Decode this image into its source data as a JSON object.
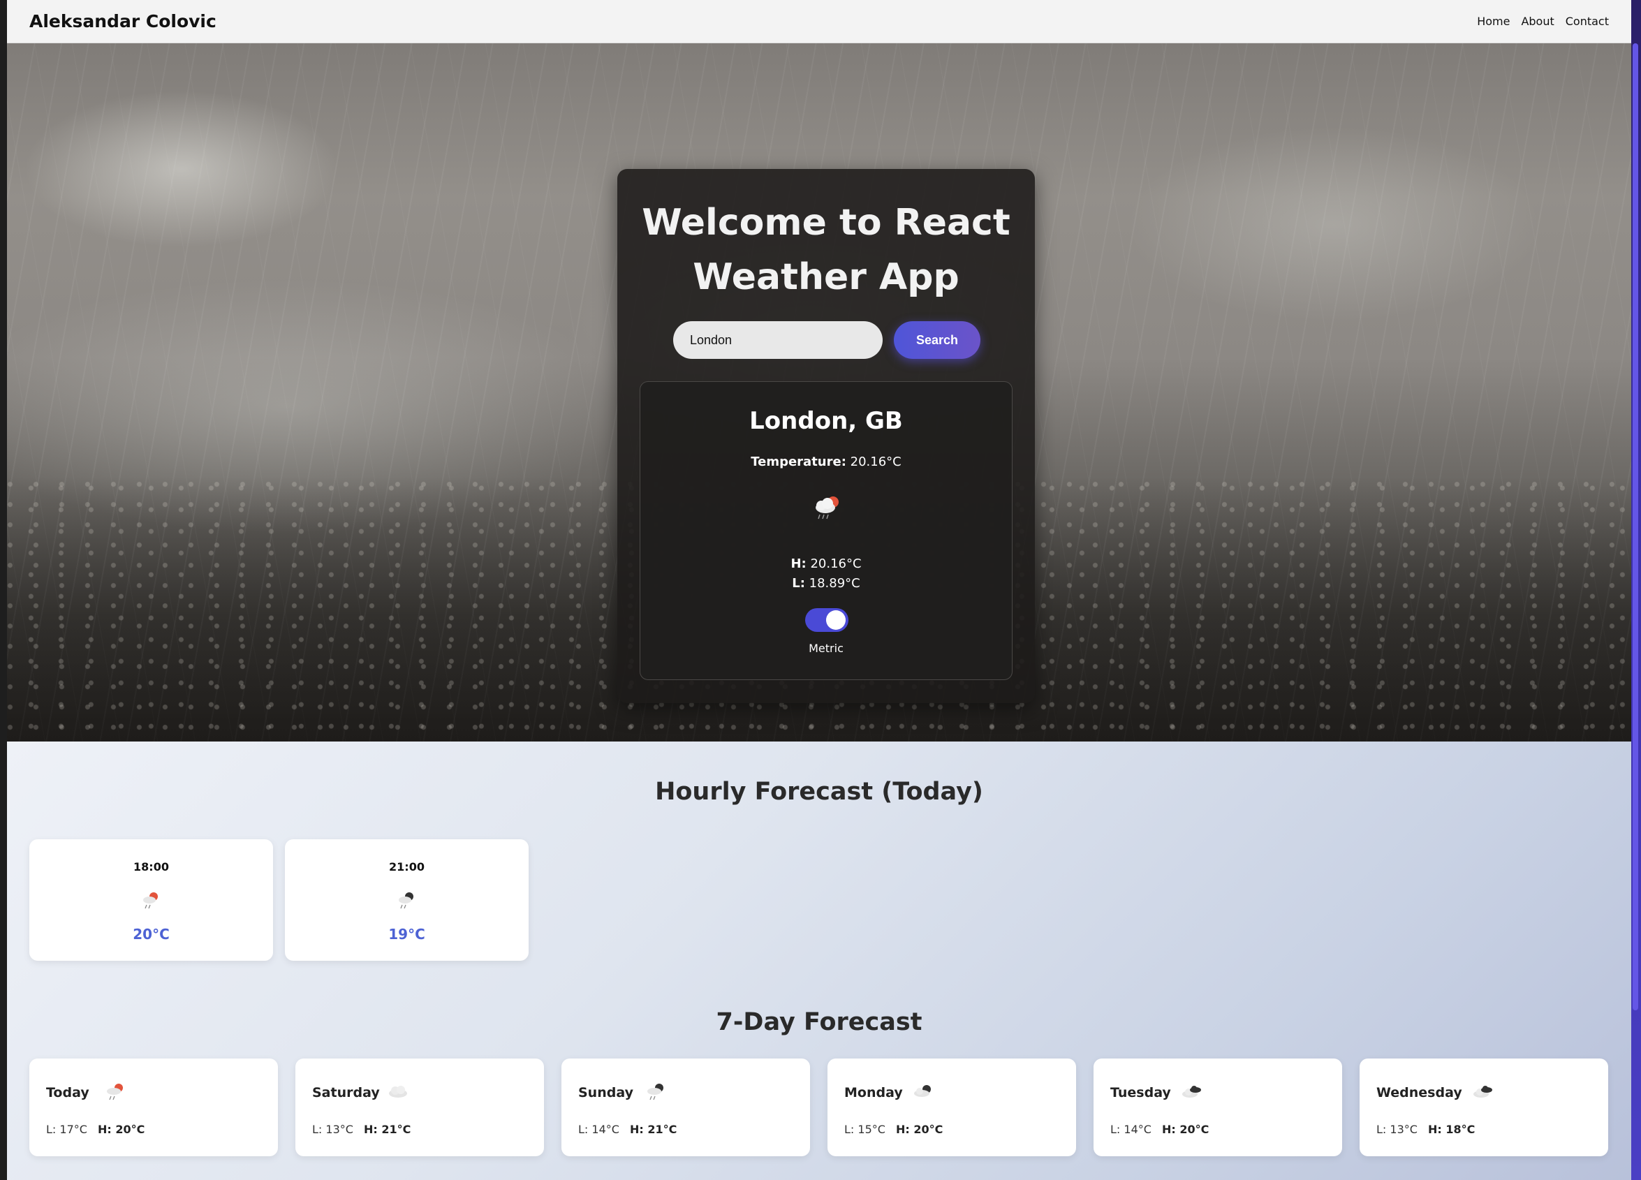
{
  "nav": {
    "brand": "Aleksandar Colovic",
    "links": [
      "Home",
      "About",
      "Contact"
    ]
  },
  "hero": {
    "title": "Welcome to React Weather App",
    "search": {
      "value": "London",
      "button_label": "Search"
    }
  },
  "current": {
    "city": "London, GB",
    "temperature_label": "Temperature:",
    "temperature_value": "20.16°C",
    "icon": "cloud-rain-sun-icon",
    "high_label": "H:",
    "high_value": "20.16°C",
    "low_label": "L:",
    "low_value": "18.89°C",
    "unit_toggle_label": "Metric",
    "unit_toggle_on": true
  },
  "hourly": {
    "title": "Hourly Forecast (Today)",
    "items": [
      {
        "time": "18:00",
        "temp": "20°C",
        "icon": "rain-sun-icon"
      },
      {
        "time": "21:00",
        "temp": "19°C",
        "icon": "rain-moon-icon"
      }
    ]
  },
  "daily": {
    "title": "7-Day Forecast",
    "items": [
      {
        "day": "Today",
        "low": "L: 17°C",
        "high": "H: 20°C",
        "icon": "rain-sun-icon"
      },
      {
        "day": "Saturday",
        "low": "L: 13°C",
        "high": "H: 21°C",
        "icon": "cloud-icon"
      },
      {
        "day": "Sunday",
        "low": "L: 14°C",
        "high": "H: 21°C",
        "icon": "rain-moon-icon"
      },
      {
        "day": "Monday",
        "low": "L: 15°C",
        "high": "H: 20°C",
        "icon": "cloud-moon-icon"
      },
      {
        "day": "Tuesday",
        "low": "L: 14°C",
        "high": "H: 20°C",
        "icon": "dark-clouds-icon"
      },
      {
        "day": "Wednesday",
        "low": "L: 13°C",
        "high": "H: 18°C",
        "icon": "dark-clouds-icon"
      }
    ]
  },
  "colors": {
    "accent": "#4d62d4",
    "button_start": "#4f55d8",
    "button_end": "#6b54c9",
    "toggle": "#4a4ad6"
  }
}
